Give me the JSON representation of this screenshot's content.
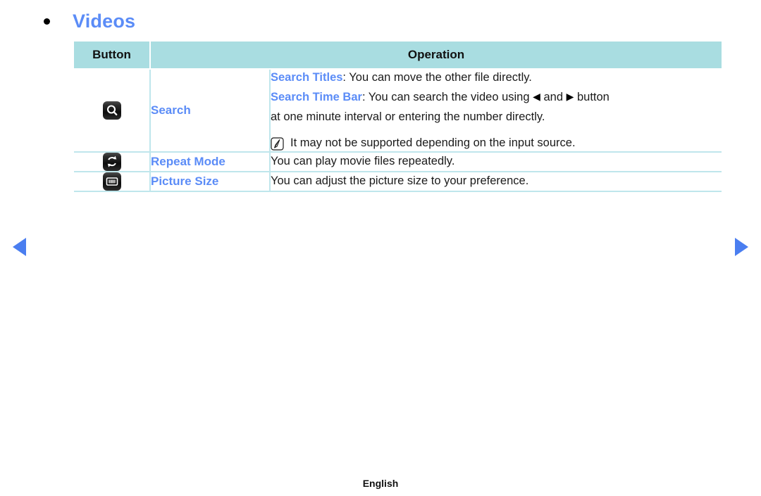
{
  "page": {
    "heading": "Videos",
    "bullet_icon": "bullet-dot-icon",
    "heading_color": "#5b8cf7",
    "accent_color": "#5b8cf7",
    "table_header_bg": "#a9dde1",
    "table_border_color": "#bfe6ec",
    "footer_language": "English"
  },
  "navigation": {
    "prev_icon": "triangle-left-icon",
    "next_icon": "triangle-right-icon",
    "arrow_color": "#4a7ef0"
  },
  "table": {
    "headers": {
      "button": "Button",
      "operation": "Operation"
    },
    "rows": [
      {
        "icon_name": "search-key-icon",
        "function": "Search",
        "operation_lines": [
          {
            "lead": "Search Titles",
            "rest": ": You can move the other file directly."
          },
          {
            "lead": "Search Time Bar",
            "rest": ": You can search the video using ",
            "arrow_left": "◀",
            "mid": " and ",
            "arrow_right": "▶",
            "tail": " button"
          },
          {
            "rest": "at one minute interval or entering the number directly."
          }
        ],
        "note": {
          "icon_name": "note-memo-icon",
          "text": "It may not be supported depending on the input source."
        }
      },
      {
        "icon_name": "repeat-key-icon",
        "function": "Repeat Mode",
        "operation_lines": [
          {
            "rest": "You can play movie files repeatedly."
          }
        ]
      },
      {
        "icon_name": "picture-size-key-icon",
        "function": "Picture Size",
        "operation_lines": [
          {
            "rest": "You can adjust the picture size to your preference."
          }
        ]
      }
    ]
  }
}
